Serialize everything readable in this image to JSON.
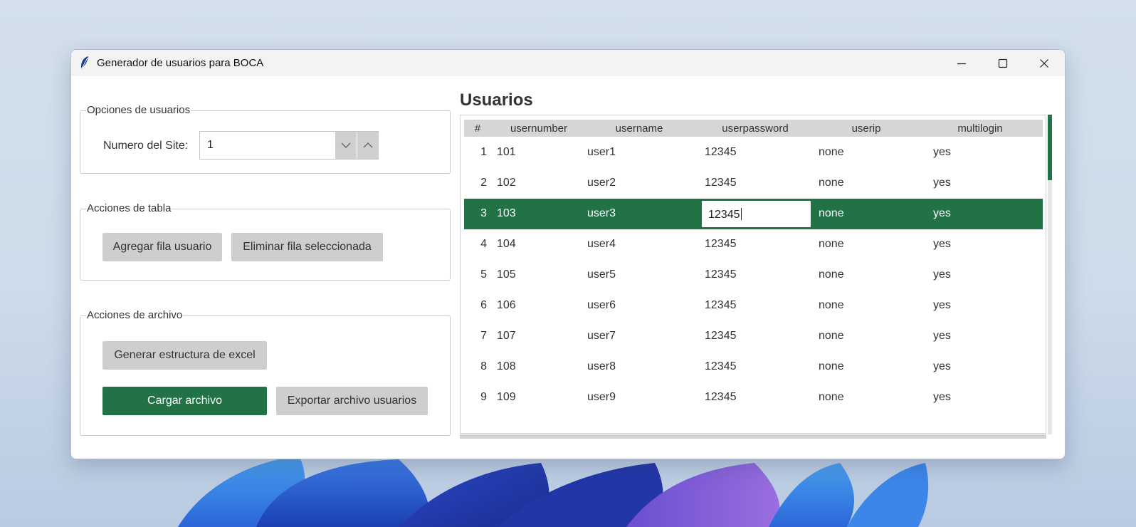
{
  "window": {
    "title": "Generador de usuarios para BOCA"
  },
  "user_options": {
    "group_label": "Opciones de usuarios",
    "site_label": "Numero del Site:",
    "site_value": "1"
  },
  "table_actions": {
    "group_label": "Acciones de tabla",
    "add_row_label": "Agregar fila usuario",
    "delete_row_label": "Eliminar fila seleccionada"
  },
  "file_actions": {
    "group_label": "Acciones de archivo",
    "generate_label": "Generar estructura de excel",
    "load_label": "Cargar archivo",
    "export_label": "Exportar archivo usuarios"
  },
  "users_table": {
    "title": "Usuarios",
    "columns": [
      "#",
      "usernumber",
      "username",
      "userpassword",
      "userip",
      "multilogin"
    ],
    "selected_row": 3,
    "editing_value": "12345",
    "rows": [
      {
        "index": "1",
        "usernumber": "101",
        "username": "user1",
        "userpassword": "12345",
        "userip": "none",
        "multilogin": "yes"
      },
      {
        "index": "2",
        "usernumber": "102",
        "username": "user2",
        "userpassword": "12345",
        "userip": "none",
        "multilogin": "yes"
      },
      {
        "index": "3",
        "usernumber": "103",
        "username": "user3",
        "userpassword": "12345",
        "userip": "none",
        "multilogin": "yes"
      },
      {
        "index": "4",
        "usernumber": "104",
        "username": "user4",
        "userpassword": "12345",
        "userip": "none",
        "multilogin": "yes"
      },
      {
        "index": "5",
        "usernumber": "105",
        "username": "user5",
        "userpassword": "12345",
        "userip": "none",
        "multilogin": "yes"
      },
      {
        "index": "6",
        "usernumber": "106",
        "username": "user6",
        "userpassword": "12345",
        "userip": "none",
        "multilogin": "yes"
      },
      {
        "index": "7",
        "usernumber": "107",
        "username": "user7",
        "userpassword": "12345",
        "userip": "none",
        "multilogin": "yes"
      },
      {
        "index": "8",
        "usernumber": "108",
        "username": "user8",
        "userpassword": "12345",
        "userip": "none",
        "multilogin": "yes"
      },
      {
        "index": "9",
        "usernumber": "109",
        "username": "user9",
        "userpassword": "12345",
        "userip": "none",
        "multilogin": "yes"
      }
    ]
  },
  "colors": {
    "accent": "#217346",
    "button_gray": "#cecece",
    "header_gray": "#d6d6d6"
  },
  "icons": {
    "app": "feather-icon",
    "minimize": "minimize-icon",
    "maximize": "maximize-icon",
    "close": "close-icon",
    "spin_down": "chevron-down-icon",
    "spin_up": "chevron-up-icon"
  }
}
